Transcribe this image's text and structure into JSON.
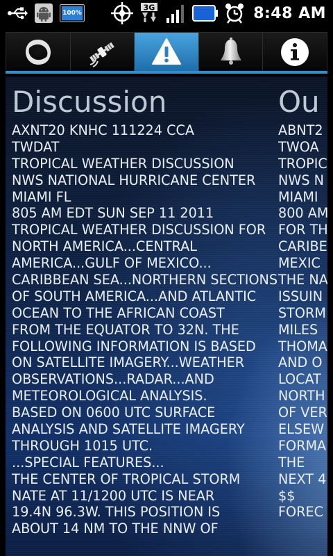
{
  "status_bar": {
    "time": "8:48 AM",
    "battery_widget_text": "100%",
    "net_label": "3G",
    "icons": [
      "usb-icon",
      "android-debug-icon",
      "battery-widget-icon",
      "gps-icon",
      "3g-data-icon",
      "signal-icon",
      "battery-icon",
      "alarm-icon"
    ]
  },
  "tabs": [
    {
      "id": "storms",
      "icon": "hurricane-icon",
      "active": false
    },
    {
      "id": "satellite",
      "icon": "satellite-icon",
      "active": false
    },
    {
      "id": "alerts",
      "icon": "warning-icon",
      "active": true
    },
    {
      "id": "notifications",
      "icon": "bell-icon",
      "active": false
    },
    {
      "id": "info",
      "icon": "info-icon",
      "active": false
    }
  ],
  "accent_color": "#2f8fd0",
  "discussion": {
    "title": "Discussion",
    "lines": [
      "AXNT20 KNHC 111224 CCA",
      "TWDAT",
      "TROPICAL WEATHER DISCUSSION",
      "NWS NATIONAL HURRICANE CENTER",
      "MIAMI FL",
      "805 AM EDT SUN SEP 11 2011",
      "TROPICAL WEATHER DISCUSSION FOR",
      "NORTH AMERICA...CENTRAL",
      "AMERICA...GULF OF MEXICO...",
      "CARIBBEAN SEA...NORTHERN SECTIONS",
      "OF SOUTH AMERICA...AND ATLANTIC",
      "OCEAN TO THE AFRICAN COAST",
      "FROM THE EQUATOR TO 32N. THE",
      "FOLLOWING INFORMATION IS BASED",
      "ON SATELLITE IMAGERY...WEATHER",
      "OBSERVATIONS...RADAR...AND",
      "METEOROLOGICAL ANALYSIS.",
      "BASED ON 0600 UTC SURFACE",
      "ANALYSIS AND SATELLITE IMAGERY",
      "THROUGH 1015 UTC.",
      "...SPECIAL FEATURES...",
      "THE CENTER OF TROPICAL STORM",
      "NATE AT 11/1200 UTC IS NEAR",
      "19.4N 96.3W. THIS POSITION IS",
      "ABOUT 14 NM TO THE NNW OF"
    ]
  },
  "outlook": {
    "title": "Ou",
    "lines": [
      "ABNT2",
      "TWOA",
      "TROPIC",
      "NWS N",
      "MIAMI",
      "800 AM",
      "FOR TH",
      "CARIBE",
      "MEXIC",
      "THE NA",
      "ISSUIN",
      "STORM",
      "MILES",
      "THOMA",
      "AND O",
      "LOCAT",
      "NORTH",
      "OF VER",
      "ELSEW",
      "FORMA",
      "THE",
      "NEXT 4",
      "$$",
      "FOREC"
    ]
  }
}
